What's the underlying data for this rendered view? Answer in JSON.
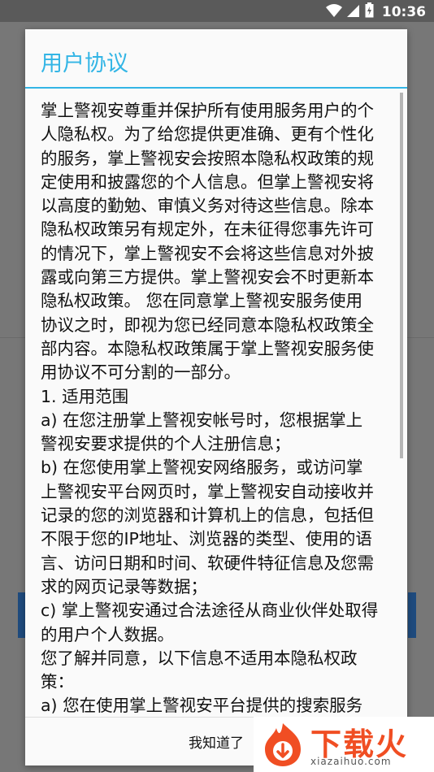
{
  "status_bar": {
    "time": "10:36"
  },
  "dialog": {
    "title": "用户协议",
    "content": "掌上警视安尊重并保护所有使用服务用户的个人隐私权。为了给您提供更准确、更有个性化的服务，掌上警视安会按照本隐私权政策的规定使用和披露您的个人信息。但掌上警视安将以高度的勤勉、审慎义务对待这些信息。除本隐私权政策另有规定外，在未征得您事先许可的情况下，掌上警视安不会将这些信息对外披露或向第三方提供。掌上警视安会不时更新本隐私权政策。 您在同意掌上警视安服务使用协议之时，即视为您已经同意本隐私权政策全部内容。本隐私权政策属于掌上警视安服务使用协议不可分割的一部分。\n1. 适用范围\na) 在您注册掌上警视安帐号时，您根据掌上警视安要求提供的个人注册信息；\nb) 在您使用掌上警视安网络服务，或访问掌上警视安平台网页时，掌上警视安自动接收并记录的您的浏览器和计算机上的信息，包括但不限于您的IP地址、浏览器的类型、使用的语言、访问日期和时间、软硬件特征信息及您需求的网页记录等数据；\nc) 掌上警视安通过合法途径从商业伙伴处取得的用户个人数据。\n您了解并同意，以下信息不适用本隐私权政策：\na) 您在使用掌上警视安平台提供的搜索服务时输入的关键字信息；",
    "ok_label": "我知道了"
  },
  "watermark": {
    "title": "下载火",
    "url": "xiazaihuo.com"
  },
  "colors": {
    "accent": "#33b5e5",
    "watermark": "#f04e23"
  }
}
